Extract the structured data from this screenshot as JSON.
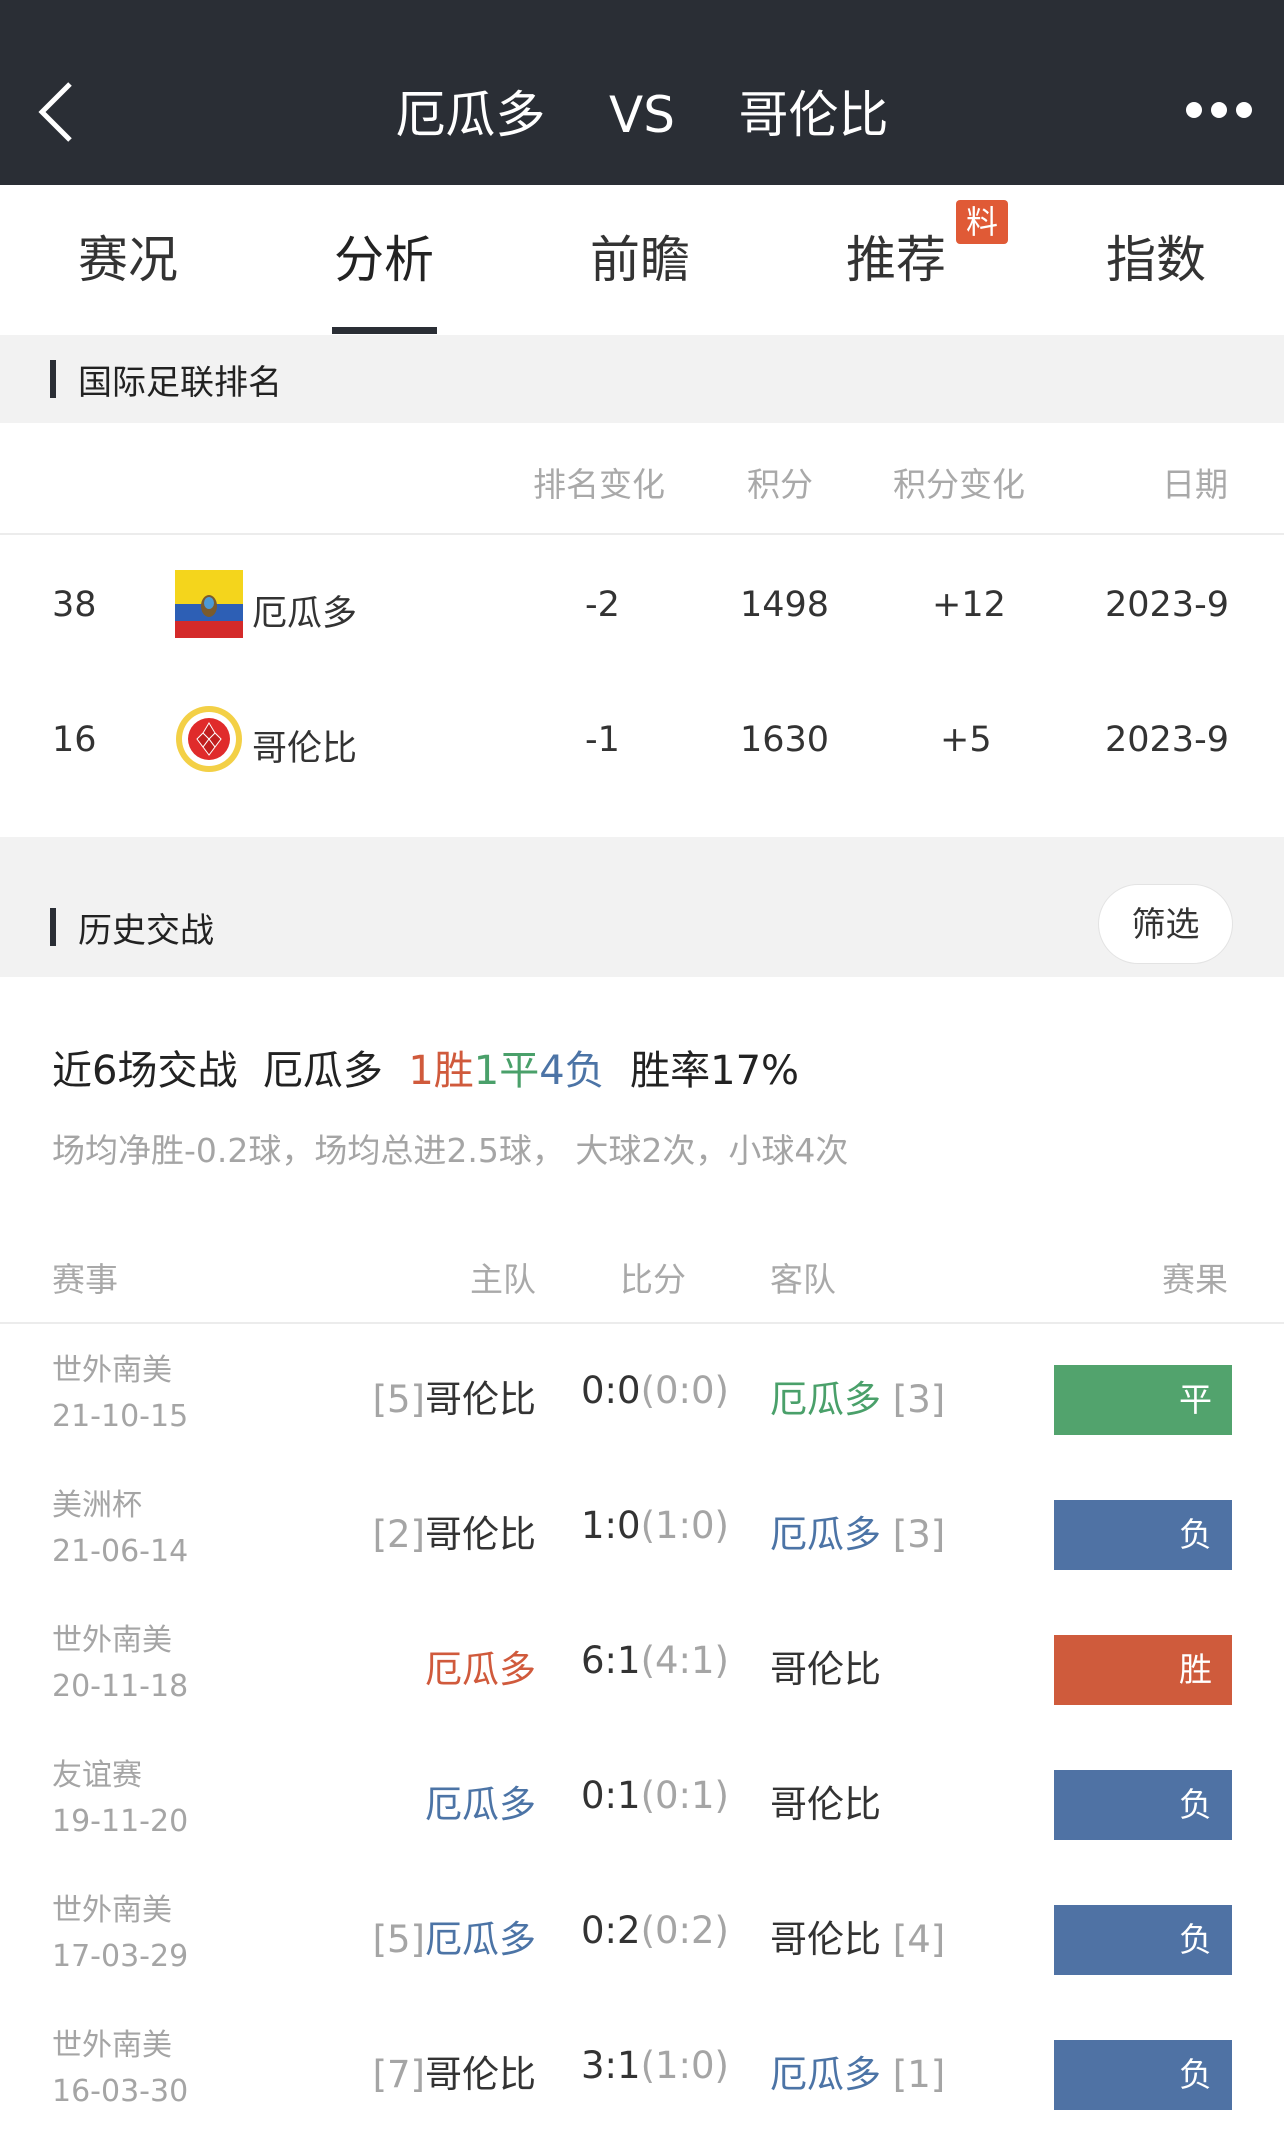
{
  "header": {
    "home": "厄瓜多",
    "vs": "VS",
    "away": "哥伦比"
  },
  "tabs": [
    "赛况",
    "分析",
    "前瞻",
    "推荐",
    "指数"
  ],
  "tab_badge": "料",
  "ranking": {
    "title": "国际足联排名",
    "columns": [
      "排名变化",
      "积分",
      "积分变化",
      "日期"
    ],
    "rows": [
      {
        "rank": "38",
        "team": "厄瓜多",
        "change": "-2",
        "points": "1498",
        "points_change": "+12",
        "date": "2023-9"
      },
      {
        "rank": "16",
        "team": "哥伦比",
        "change": "-1",
        "points": "1630",
        "points_change": "+5",
        "date": "2023-9"
      }
    ]
  },
  "history": {
    "title": "历史交战",
    "filter_label": "筛选",
    "summary": {
      "prefix": "近6场交战",
      "team": "厄瓜多",
      "wins": "1胜",
      "draws": "1平",
      "losses": "4负",
      "win_rate": "胜率17%"
    },
    "stats": "场均净胜-0.2球，场均总进2.5球， 大球2次，小球4次",
    "columns": [
      "赛事",
      "主队",
      "比分",
      "客队",
      "赛果"
    ],
    "matches": [
      {
        "comp": "世外南美",
        "date": "21-10-15",
        "home_rank": "[5]",
        "home": "哥伦比",
        "score": "0:0",
        "ht": "(0:0)",
        "away": "厄瓜多",
        "away_rank": "[3]",
        "result": "平"
      },
      {
        "comp": "美洲杯",
        "date": "21-06-14",
        "home_rank": "[2]",
        "home": "哥伦比",
        "score": "1:0",
        "ht": "(1:0)",
        "away": "厄瓜多",
        "away_rank": "[3]",
        "result": "负"
      },
      {
        "comp": "世外南美",
        "date": "20-11-18",
        "home_rank": "",
        "home": "厄瓜多",
        "score": "6:1",
        "ht": "(4:1)",
        "away": "哥伦比",
        "away_rank": "",
        "result": "胜"
      },
      {
        "comp": "友谊赛",
        "date": "19-11-20",
        "home_rank": "",
        "home": "厄瓜多",
        "score": "0:1",
        "ht": "(0:1)",
        "away": "哥伦比",
        "away_rank": "",
        "result": "负"
      },
      {
        "comp": "世外南美",
        "date": "17-03-29",
        "home_rank": "[5]",
        "home": "厄瓜多",
        "score": "0:2",
        "ht": "(0:2)",
        "away": "哥伦比",
        "away_rank": "[4]",
        "result": "负"
      },
      {
        "comp": "世外南美",
        "date": "16-03-30",
        "home_rank": "[7]",
        "home": "哥伦比",
        "score": "3:1",
        "ht": "(1:0)",
        "away": "厄瓜多",
        "away_rank": "[1]",
        "result": "负"
      }
    ]
  },
  "colors": {
    "header_bg": "#2a2e35",
    "win": "#cf5b3c",
    "draw": "#52a36d",
    "loss": "#4f72a4"
  }
}
